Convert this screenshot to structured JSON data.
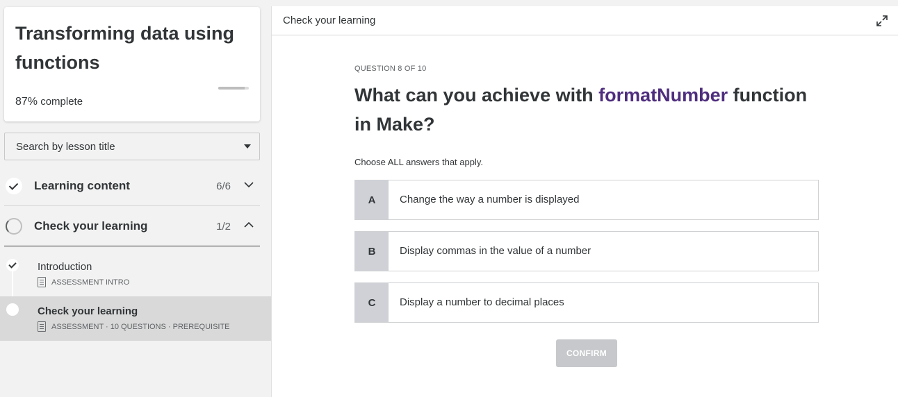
{
  "course": {
    "title": "Transforming data using functions",
    "progress_percent": "87%",
    "progress_suffix": " complete",
    "progress_fraction": 0.87
  },
  "search": {
    "placeholder": "Search by lesson title",
    "icon": "caret-down-icon"
  },
  "sections": [
    {
      "title": "Learning content",
      "count": "6/6",
      "state": "complete",
      "chevron": "chevron-down-icon"
    },
    {
      "title": "Check your learning",
      "count": "1/2",
      "state": "in-progress",
      "chevron": "chevron-up-icon"
    }
  ],
  "lessons": [
    {
      "title": "Introduction",
      "meta": "ASSESSMENT INTRO",
      "state": "complete"
    },
    {
      "title": "Check your learning",
      "meta": "ASSESSMENT · 10 QUESTIONS  ·  PREREQUISITE",
      "state": "current"
    }
  ],
  "main": {
    "header_title": "Check your learning",
    "expand_icon": "expand-icon",
    "question_label": "QUESTION 8 OF 10",
    "question_prefix": "What can you achieve with ",
    "question_highlight": "formatNumber",
    "question_suffix": " function in Make?",
    "instruction": "Choose ALL answers that apply.",
    "options": [
      {
        "letter": "A",
        "text": "Change the way a number is displayed"
      },
      {
        "letter": "B",
        "text": "Display commas in the value of a number"
      },
      {
        "letter": "C",
        "text": "Display a number to decimal places"
      }
    ],
    "confirm_label": "CONFIRM"
  },
  "colors": {
    "highlight": "#4f2e7e",
    "option_letter_bg": "#cfd1d7",
    "confirm_disabled_bg": "#c6c8cb"
  }
}
